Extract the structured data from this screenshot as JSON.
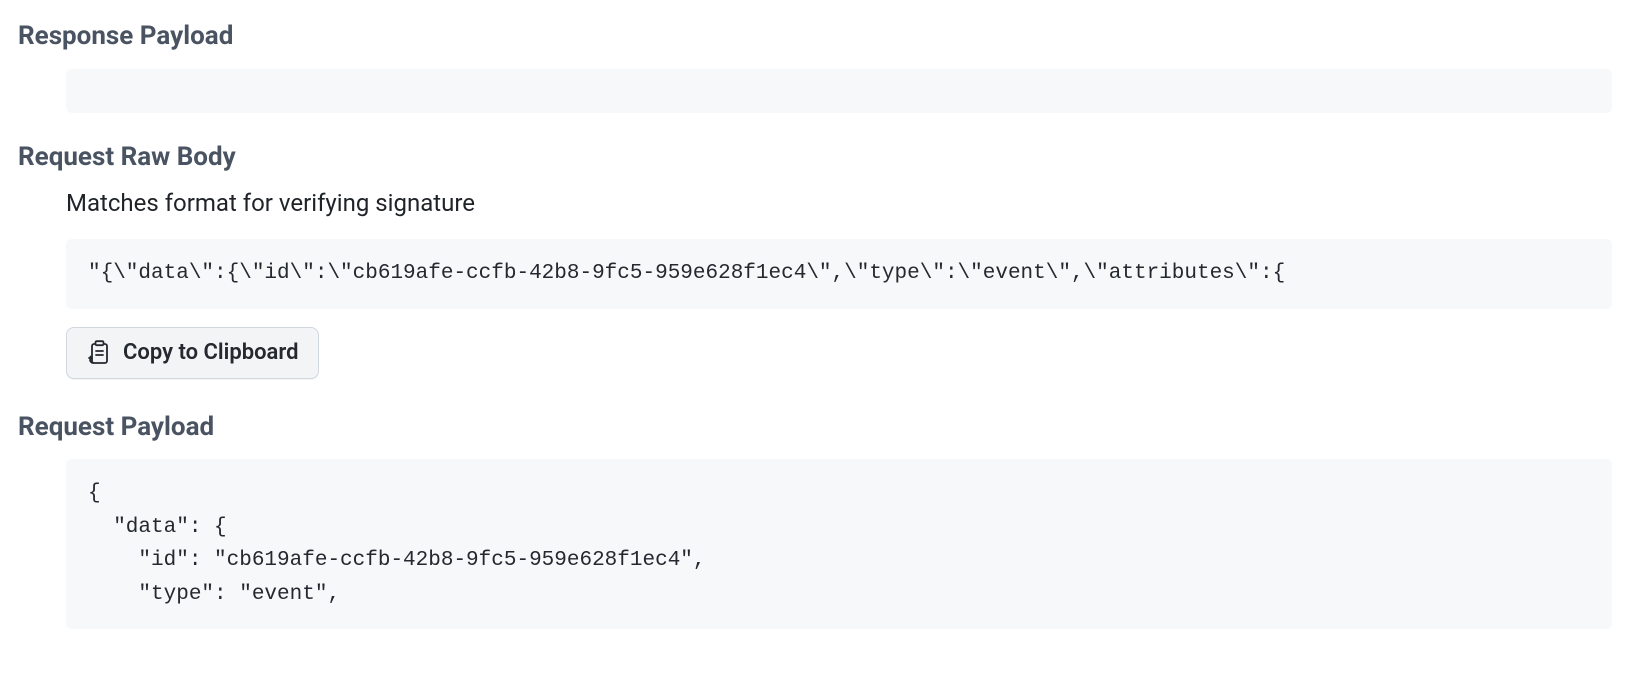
{
  "sections": {
    "response_payload": {
      "heading": "Response Payload",
      "body": ""
    },
    "request_raw_body": {
      "heading": "Request Raw Body",
      "description": "Matches format for verifying signature",
      "body": "\"{\\\"data\\\":{\\\"id\\\":\\\"cb619afe-ccfb-42b8-9fc5-959e628f1ec4\\\",\\\"type\\\":\\\"event\\\",\\\"attributes\\\":{",
      "copy_button_label": "Copy to Clipboard"
    },
    "request_payload": {
      "heading": "Request Payload",
      "body": "{\n  \"data\": {\n    \"id\": \"cb619afe-ccfb-42b8-9fc5-959e628f1ec4\",\n    \"type\": \"event\","
    }
  }
}
